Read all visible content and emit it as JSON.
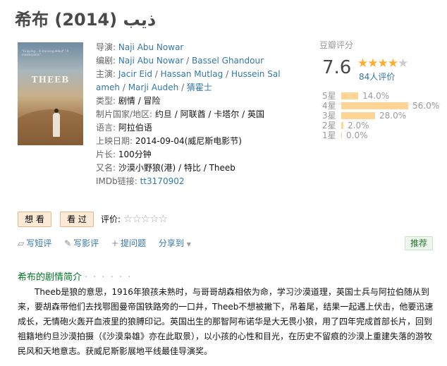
{
  "title": "希布 ذيب (2014)",
  "poster": {
    "title_text": "THEEB",
    "tagline": "\"Gripping... A stunning debut\" \"A masterpiece\""
  },
  "info": {
    "director_label": "导演:",
    "director": "Naji Abu Nowar",
    "writer_label": "编剧:",
    "writers": [
      "Naji Abu Nowar",
      "Bassel Ghandour"
    ],
    "cast_label": "主演:",
    "cast_line1": [
      "Jacir Eid",
      "Hassan Mutlag",
      "Hussein Sal"
    ],
    "cast_line2": [
      "ameh",
      "Marji Audeh",
      "猜霍士"
    ],
    "genre_label": "类型:",
    "genre": "剧情 / 冒险",
    "country_label": "制片国家/地区:",
    "country": "约旦 / 阿联酋 / 卡塔尔 / 英国",
    "language_label": "语言:",
    "language": "阿拉伯语",
    "release_label": "上映日期:",
    "release": "2014-09-04(威尼斯电影节)",
    "runtime_label": "片长:",
    "runtime": "100分钟",
    "aka_label": "又名:",
    "aka": "沙漠小野狼(港) / 特比 / Theeb",
    "imdb_label": "IMDb链接:",
    "imdb": "tt3170902"
  },
  "rating": {
    "header": "豆瓣评分",
    "score": "7.6",
    "stars_on": "★★★★",
    "stars_off": "★",
    "count": "84人评价",
    "distribution": [
      {
        "label": "5星",
        "pct_text": "14.0%",
        "pct": 14.0
      },
      {
        "label": "4星",
        "pct_text": "56.0%",
        "pct": 56.0
      },
      {
        "label": "3星",
        "pct_text": "28.0%",
        "pct": 28.0
      },
      {
        "label": "2星",
        "pct_text": "2.0%",
        "pct": 2.0
      },
      {
        "label": "1星",
        "pct_text": "0.0%",
        "pct": 0.0
      }
    ]
  },
  "actions": {
    "want_label": "想 看",
    "seen_label": "看 过",
    "rate_label": "评价:",
    "rate_stars": "☆☆☆☆☆",
    "write_short": "写短评",
    "write_review": "写影评",
    "ask": "提问题",
    "share": "分享到",
    "share_arrow": "▼",
    "recommend": "推荐"
  },
  "synopsis": {
    "heading": "希布的剧情简介",
    "dots": "· · · · · ·",
    "text": "Theeb是狼的意思，1916年狼孩未熟时，与哥哥胡森相依为命，学习沙漠道理，英国士兵与阿拉伯随从到来，要胡森带他们去找鄂图曼帝国铁路旁的一口井，Theeb不想被撇下，吊着尾，结果一起遇上伏击，他要迅速成长，无情砲火轰开血液里的狼膊印记。英国出生的那智阿布诺华是大无畏小狼，用了四年完成首部长片，回到祖籍地约旦沙漠拍摄（《沙漠枭雄》亦在此取景），以小孩的心性和目光，在历史不留痕的沙漠上重建失落的游牧民风和天地意志。获威尼斯影展地平线最佳导演奖。"
  }
}
